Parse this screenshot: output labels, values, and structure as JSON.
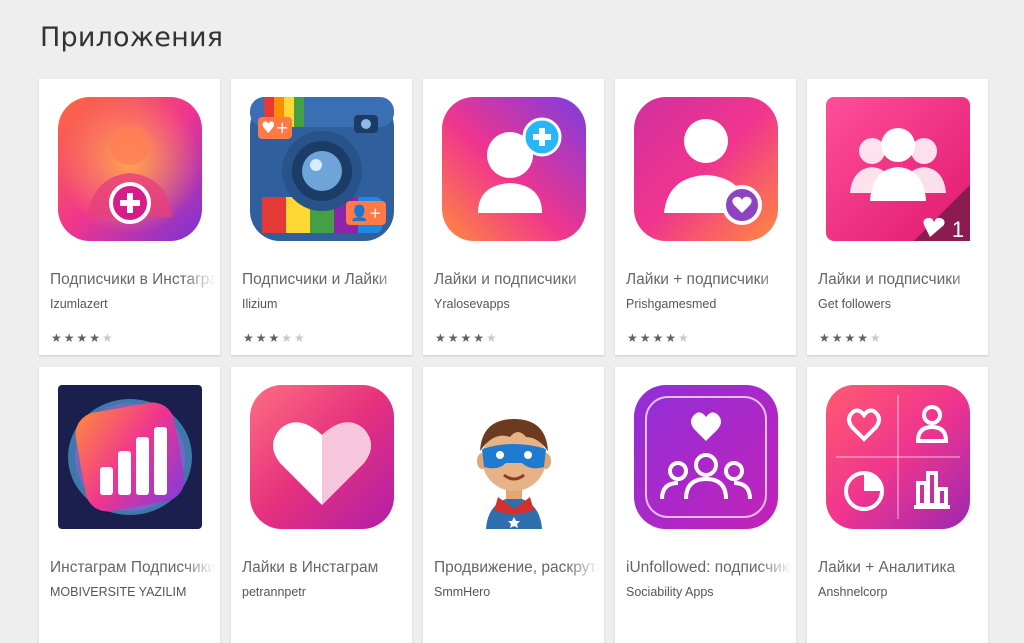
{
  "section": {
    "title": "Приложения"
  },
  "apps": [
    {
      "title": "Подписчики в Инстаграм",
      "developer": "Izumlazert",
      "rating": 4.5,
      "icon": "person-plus-icon"
    },
    {
      "title": "Подписчики и Лайки",
      "developer": "Ilizium",
      "rating": 3.5,
      "icon": "camera-icon"
    },
    {
      "title": "Лайки и подписчики",
      "developer": "Yralosevapps",
      "rating": 4.5,
      "icon": "add-user-icon"
    },
    {
      "title": "Лайки + подписчики",
      "developer": "Prishgamesmed",
      "rating": 4.5,
      "icon": "user-heart-icon"
    },
    {
      "title": "Лайки и подписчики",
      "developer": "Get followers",
      "rating": 4.5,
      "icon": "group-likes-icon"
    },
    {
      "title": "Инстаграм Подписчики",
      "developer": "MOBIVERSITE YAZILIM",
      "rating": null,
      "icon": "bar-chart-icon"
    },
    {
      "title": "Лайки в Инстаграм",
      "developer": "petrannpetr",
      "rating": null,
      "icon": "heart-icon"
    },
    {
      "title": "Продвижение, раскрутка",
      "developer": "SmmHero",
      "rating": null,
      "icon": "superhero-icon"
    },
    {
      "title": "iUnfollowed: подписчики",
      "developer": "Sociability Apps",
      "rating": null,
      "icon": "followers-heart-icon"
    },
    {
      "title": "Лайки + Аналитика",
      "developer": "Anshnelcorp",
      "rating": null,
      "icon": "analytics-icon"
    }
  ],
  "colors": {
    "pink": "#f0358e",
    "magenta": "#c41fa3",
    "orange": "#ff8a3d",
    "purple": "#8a2be2",
    "blue": "#2f6fb0",
    "star": "#616161"
  }
}
